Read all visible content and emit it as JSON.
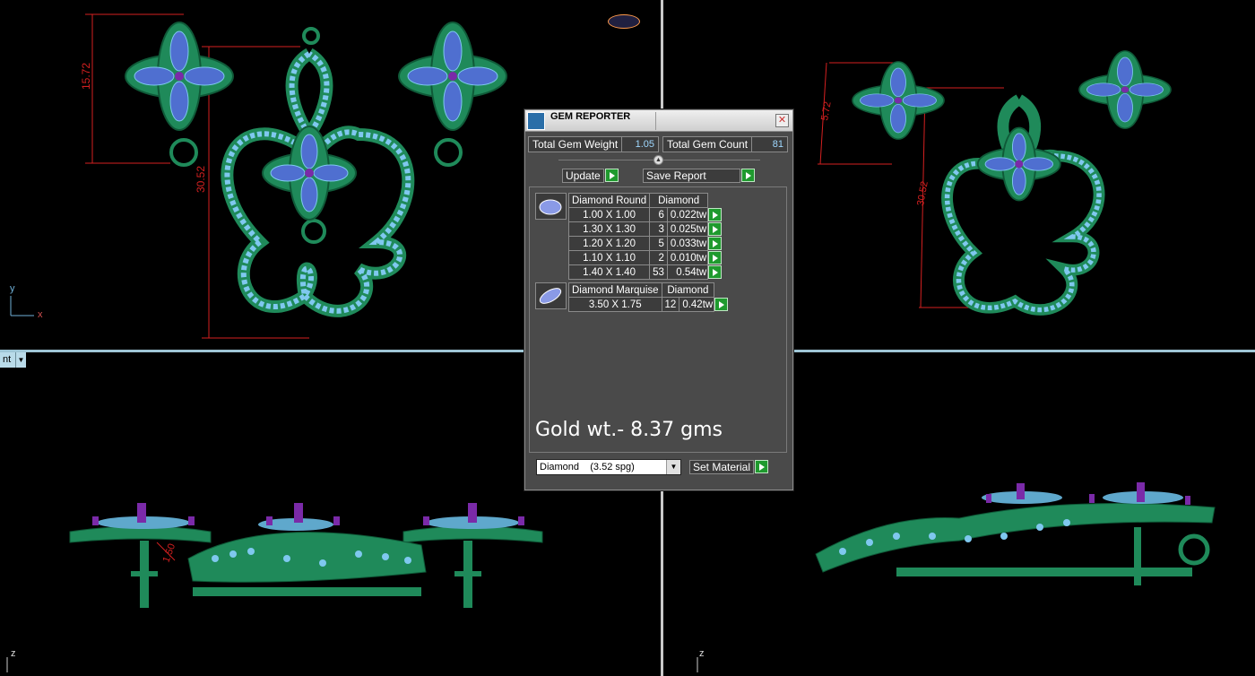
{
  "dialog": {
    "title": "GEM REPORTER",
    "total_weight_label": "Total Gem Weight",
    "total_weight_value": "1.05",
    "total_count_label": "Total Gem Count",
    "total_count_value": "81",
    "update_label": "Update",
    "save_report_label": "Save Report",
    "groups": [
      {
        "shape": "Diamond Round",
        "material": "Diamond",
        "rows": [
          {
            "size": "1.00 X 1.00",
            "count": "6",
            "weight": "0.022tw"
          },
          {
            "size": "1.30 X 1.30",
            "count": "3",
            "weight": "0.025tw"
          },
          {
            "size": "1.20 X 1.20",
            "count": "5",
            "weight": "0.033tw"
          },
          {
            "size": "1.10 X 1.10",
            "count": "2",
            "weight": "0.010tw"
          },
          {
            "size": "1.40 X 1.40",
            "count": "53",
            "weight": "0.54tw"
          }
        ]
      },
      {
        "shape": "Diamond Marquise",
        "material": "Diamond",
        "rows": [
          {
            "size": "3.50 X 1.75",
            "count": "12",
            "weight": "0.42tw"
          }
        ]
      }
    ],
    "gold_note": "Gold wt.- 8.37 gms",
    "material_select": "Diamond    (3.52 spg)",
    "set_material_label": "Set Material"
  },
  "viewports": {
    "front_dims": [
      "15.72",
      "30.52"
    ],
    "side_dim": "1.50",
    "persp_dims": [
      "5.72",
      "30.52"
    ],
    "axis_y": "y",
    "axis_x": "x",
    "axis_z": "z",
    "view_tab": "nt"
  },
  "colors": {
    "metal": "#1f8a5a",
    "metal_dark": "#0f5a38",
    "diamond_light": "#7fc8ef",
    "stone_blue": "#4f6fd0",
    "stone_purple": "#7a2aa8",
    "dimension_red": "#d42020",
    "dialog_bg": "#4a4a4a"
  }
}
